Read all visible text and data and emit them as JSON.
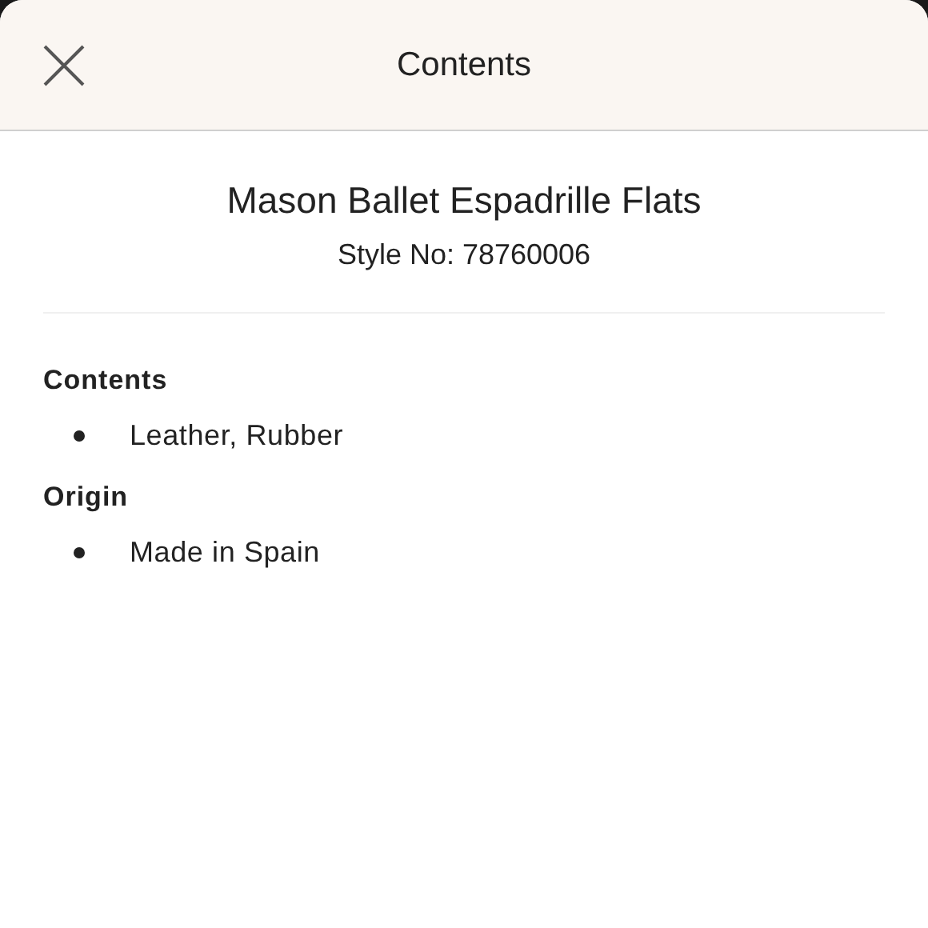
{
  "header": {
    "title": "Contents"
  },
  "product": {
    "name": "Mason Ballet Espadrille Flats",
    "style_no": "Style No: 78760006"
  },
  "sections": [
    {
      "heading": "Contents",
      "items": [
        "Leather, Rubber"
      ]
    },
    {
      "heading": "Origin",
      "items": [
        "Made in Spain"
      ]
    }
  ]
}
